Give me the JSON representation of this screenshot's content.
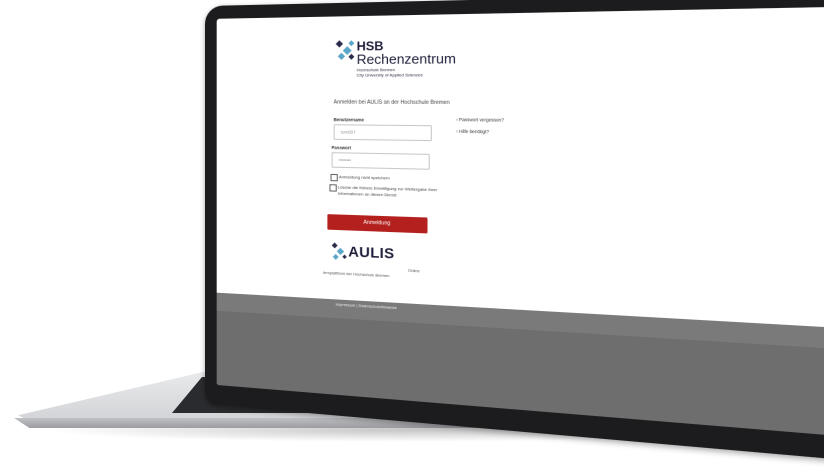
{
  "branding": {
    "hsb_line1": "HSB",
    "hsb_line2": "Rechenzentrum",
    "hsb_sub1": "Hochschule Bremen",
    "hsb_sub2": "City University of Applied Sciences"
  },
  "login": {
    "title": "Anmelden bei AULIS an der Hochschule Bremen",
    "username_label": "Benutzername",
    "username_placeholder": "tom007",
    "password_label": "Passwort",
    "password_value": "••••••••",
    "checkbox_no_save": "Anmeldung nicht speichern",
    "checkbox_consent": "Lösche die frühere Einwilligung zur Weitergabe Ihrer Informationen an diesen Dienst.",
    "button_label": "Anmeldung"
  },
  "links": {
    "forgot_password": "› Passwort vergessen?",
    "help": "› Hilfe benötigt?"
  },
  "aulis": {
    "logo_text": "AULIS",
    "online_word": "Online",
    "subtitle": "lernplattform der Hochschule Bremen"
  },
  "footer": {
    "text": "Impressum | Datenschutzhinweise"
  },
  "colors": {
    "brand_red": "#b3201d",
    "logo_blue": "#5aa6c9",
    "footer_gray": "#6e6e6e"
  }
}
